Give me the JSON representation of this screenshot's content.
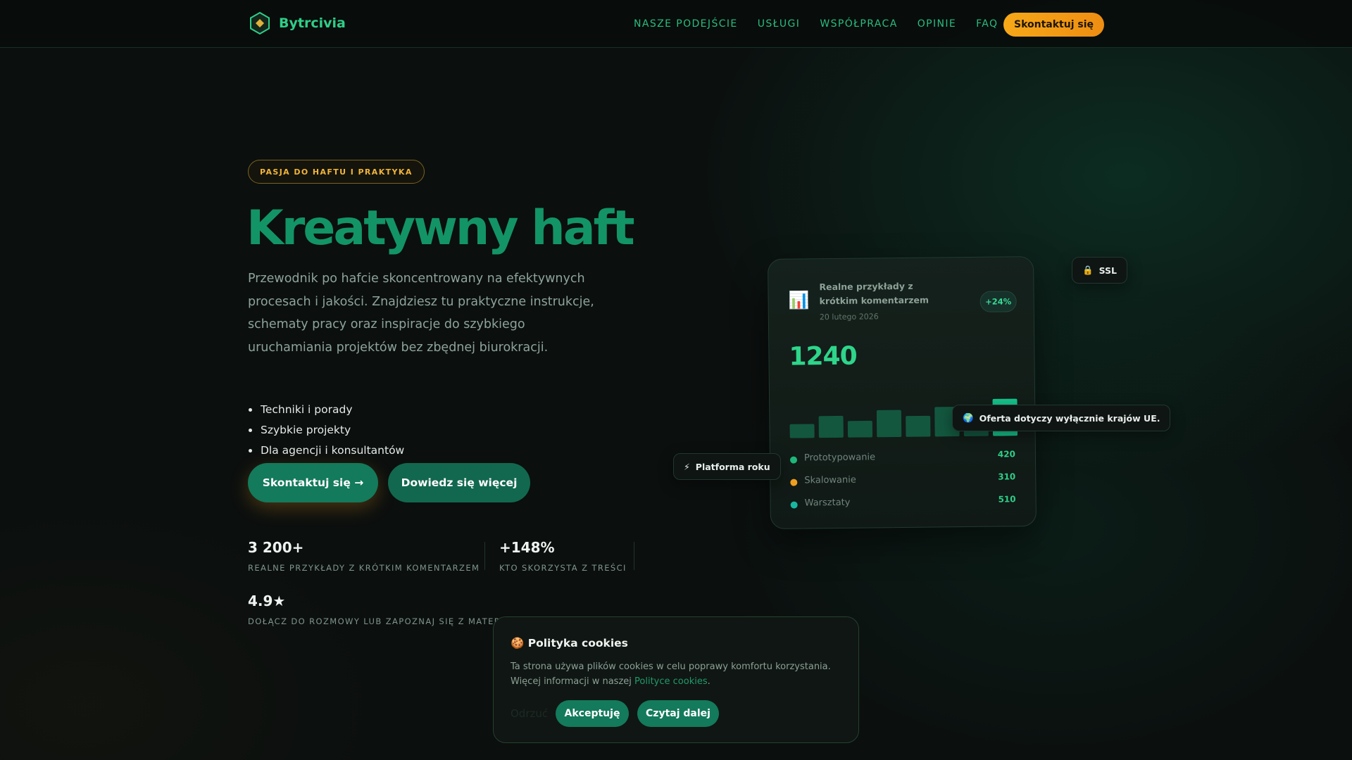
{
  "brand": {
    "name": "Bytrcivia",
    "logo_icon": "hexagon-diamond-icon"
  },
  "nav": {
    "links": [
      "NASZE PODEJŚCIE",
      "USŁUGI",
      "WSPÓŁPRACA",
      "OPINIE",
      "FAQ"
    ],
    "cta_label": "Skontaktuj się"
  },
  "hero": {
    "badge": "PASJA DO HAFTU I PRAKTYKA",
    "title": "Kreatywny haft",
    "description": "Przewodnik po hafcie skoncentrowany na efektywnych procesach i jakości. Znajdziesz tu praktyczne instrukcje, schematy pracy oraz inspiracje do szybkiego uruchamiania projektów bez zbędnej biurokracji.",
    "features": [
      "Techniki i porady",
      "Szybkie projekty",
      "Dla agencji i konsultantów"
    ],
    "primary_button": "Skontaktuj się →",
    "secondary_button": "Dowiedz się więcej"
  },
  "stats": [
    {
      "value": "3 200+",
      "label": "REALNE PRZYKŁADY Z KRÓTKIM KOMENTARZEM"
    },
    {
      "value": "+148%",
      "label": "KTO SKORZYSTA Z TREŚCI"
    },
    {
      "value": "4.9★",
      "label": "DOŁĄCZ DO ROZMOWY LUB ZAPOZNAJ SIĘ Z MATERIA"
    }
  ],
  "dashboard": {
    "icon": "bar-chart-icon",
    "title": "Realne przykłady z krótkim komentarzem",
    "date": "20 lutego 2026",
    "delta": "+24%",
    "value": "1240",
    "bars": [
      0.32,
      0.5,
      0.38,
      0.62,
      0.48,
      0.68,
      0.55,
      0.85
    ],
    "legend": [
      {
        "label": "Prototypowanie",
        "value": "420",
        "color": "#1fb87a"
      },
      {
        "label": "Skalowanie",
        "value": "310",
        "color": "#f0a020"
      },
      {
        "label": "Warsztaty",
        "value": "510",
        "color": "#18b8a0"
      }
    ]
  },
  "chips": {
    "ssl": {
      "icon": "lock-icon",
      "label": "SSL"
    },
    "eu": {
      "icon": "globe-icon",
      "label": "Oferta dotyczy wyłącznie krajów UE."
    },
    "platform": {
      "icon": "lightning-icon",
      "label": "Platforma roku"
    }
  },
  "cookie": {
    "icon": "cookie-icon",
    "title": "Polityka cookies",
    "text_before": "Ta strona używa plików cookies w celu poprawy komfortu korzystania. Więcej informacji w naszej ",
    "link": "Polityce cookies",
    "text_after": ".",
    "reject": "Odrzuć",
    "accept": "Akceptuję",
    "more": "Czytaj dalej"
  },
  "colors": {
    "accent": "#139466",
    "cta": "#f6a818",
    "button": "#137a5b"
  }
}
